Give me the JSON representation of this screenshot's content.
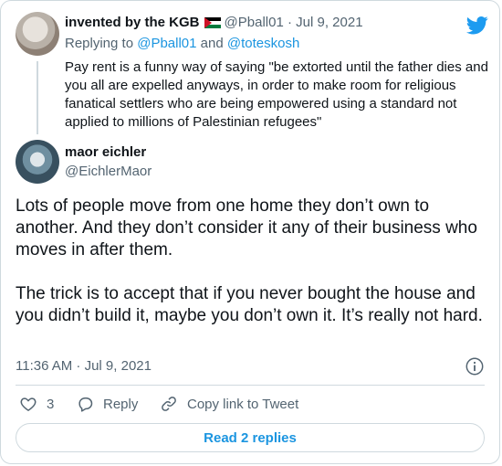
{
  "parent_tweet": {
    "name": "invented by the KGB",
    "handle": "@Pball01",
    "separator": "·",
    "date": "Jul 9, 2021",
    "replying_prefix": "Replying to",
    "reply_handle_1": "@Pball01",
    "reply_and": "and",
    "reply_handle_2": "@toteskosh",
    "text": "Pay rent is a funny way of saying \"be extorted until the father dies and you all are expelled anyways, in order to make room for religious fanatical settlers who are being empowered using a standard not applied to millions of Palestinian refugees\""
  },
  "main_tweet": {
    "name": "maor eichler",
    "handle": "@EichlerMaor",
    "paragraph_1": "Lots of people move from one home they don’t own to another. And they don’t consider it any of their business who moves in after them.",
    "paragraph_2": "The trick is to accept that if you never bought the house and you didn’t build it, maybe you don’t own it. It’s really not hard.",
    "timestamp": "11:36 AM · Jul 9, 2021"
  },
  "actions": {
    "like_count": "3",
    "reply_label": "Reply",
    "copy_link_label": "Copy link to Tweet"
  },
  "read_replies_label": "Read 2 replies",
  "colors": {
    "link": "#1b95e0",
    "muted": "#536471",
    "border": "#cfd9de",
    "text": "#0f1419"
  },
  "icons": [
    "twitter-bird-icon",
    "info-icon",
    "heart-icon",
    "reply-icon",
    "link-icon",
    "palestine-flag-icon"
  ]
}
